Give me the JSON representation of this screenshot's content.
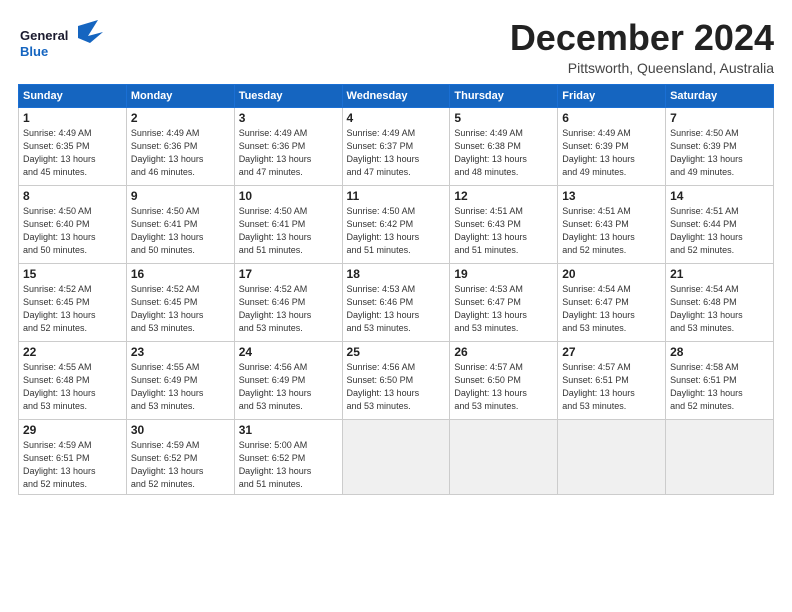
{
  "logo": {
    "general": "General",
    "blue": "Blue",
    "bird": "▶"
  },
  "title": "December 2024",
  "subtitle": "Pittsworth, Queensland, Australia",
  "headers": [
    "Sunday",
    "Monday",
    "Tuesday",
    "Wednesday",
    "Thursday",
    "Friday",
    "Saturday"
  ],
  "weeks": [
    [
      {
        "day": "1",
        "detail": "Sunrise: 4:49 AM\nSunset: 6:35 PM\nDaylight: 13 hours\nand 45 minutes."
      },
      {
        "day": "2",
        "detail": "Sunrise: 4:49 AM\nSunset: 6:36 PM\nDaylight: 13 hours\nand 46 minutes."
      },
      {
        "day": "3",
        "detail": "Sunrise: 4:49 AM\nSunset: 6:36 PM\nDaylight: 13 hours\nand 47 minutes."
      },
      {
        "day": "4",
        "detail": "Sunrise: 4:49 AM\nSunset: 6:37 PM\nDaylight: 13 hours\nand 47 minutes."
      },
      {
        "day": "5",
        "detail": "Sunrise: 4:49 AM\nSunset: 6:38 PM\nDaylight: 13 hours\nand 48 minutes."
      },
      {
        "day": "6",
        "detail": "Sunrise: 4:49 AM\nSunset: 6:39 PM\nDaylight: 13 hours\nand 49 minutes."
      },
      {
        "day": "7",
        "detail": "Sunrise: 4:50 AM\nSunset: 6:39 PM\nDaylight: 13 hours\nand 49 minutes."
      }
    ],
    [
      {
        "day": "8",
        "detail": "Sunrise: 4:50 AM\nSunset: 6:40 PM\nDaylight: 13 hours\nand 50 minutes."
      },
      {
        "day": "9",
        "detail": "Sunrise: 4:50 AM\nSunset: 6:41 PM\nDaylight: 13 hours\nand 50 minutes."
      },
      {
        "day": "10",
        "detail": "Sunrise: 4:50 AM\nSunset: 6:41 PM\nDaylight: 13 hours\nand 51 minutes."
      },
      {
        "day": "11",
        "detail": "Sunrise: 4:50 AM\nSunset: 6:42 PM\nDaylight: 13 hours\nand 51 minutes."
      },
      {
        "day": "12",
        "detail": "Sunrise: 4:51 AM\nSunset: 6:43 PM\nDaylight: 13 hours\nand 51 minutes."
      },
      {
        "day": "13",
        "detail": "Sunrise: 4:51 AM\nSunset: 6:43 PM\nDaylight: 13 hours\nand 52 minutes."
      },
      {
        "day": "14",
        "detail": "Sunrise: 4:51 AM\nSunset: 6:44 PM\nDaylight: 13 hours\nand 52 minutes."
      }
    ],
    [
      {
        "day": "15",
        "detail": "Sunrise: 4:52 AM\nSunset: 6:45 PM\nDaylight: 13 hours\nand 52 minutes."
      },
      {
        "day": "16",
        "detail": "Sunrise: 4:52 AM\nSunset: 6:45 PM\nDaylight: 13 hours\nand 53 minutes."
      },
      {
        "day": "17",
        "detail": "Sunrise: 4:52 AM\nSunset: 6:46 PM\nDaylight: 13 hours\nand 53 minutes."
      },
      {
        "day": "18",
        "detail": "Sunrise: 4:53 AM\nSunset: 6:46 PM\nDaylight: 13 hours\nand 53 minutes."
      },
      {
        "day": "19",
        "detail": "Sunrise: 4:53 AM\nSunset: 6:47 PM\nDaylight: 13 hours\nand 53 minutes."
      },
      {
        "day": "20",
        "detail": "Sunrise: 4:54 AM\nSunset: 6:47 PM\nDaylight: 13 hours\nand 53 minutes."
      },
      {
        "day": "21",
        "detail": "Sunrise: 4:54 AM\nSunset: 6:48 PM\nDaylight: 13 hours\nand 53 minutes."
      }
    ],
    [
      {
        "day": "22",
        "detail": "Sunrise: 4:55 AM\nSunset: 6:48 PM\nDaylight: 13 hours\nand 53 minutes."
      },
      {
        "day": "23",
        "detail": "Sunrise: 4:55 AM\nSunset: 6:49 PM\nDaylight: 13 hours\nand 53 minutes."
      },
      {
        "day": "24",
        "detail": "Sunrise: 4:56 AM\nSunset: 6:49 PM\nDaylight: 13 hours\nand 53 minutes."
      },
      {
        "day": "25",
        "detail": "Sunrise: 4:56 AM\nSunset: 6:50 PM\nDaylight: 13 hours\nand 53 minutes."
      },
      {
        "day": "26",
        "detail": "Sunrise: 4:57 AM\nSunset: 6:50 PM\nDaylight: 13 hours\nand 53 minutes."
      },
      {
        "day": "27",
        "detail": "Sunrise: 4:57 AM\nSunset: 6:51 PM\nDaylight: 13 hours\nand 53 minutes."
      },
      {
        "day": "28",
        "detail": "Sunrise: 4:58 AM\nSunset: 6:51 PM\nDaylight: 13 hours\nand 52 minutes."
      }
    ],
    [
      {
        "day": "29",
        "detail": "Sunrise: 4:59 AM\nSunset: 6:51 PM\nDaylight: 13 hours\nand 52 minutes."
      },
      {
        "day": "30",
        "detail": "Sunrise: 4:59 AM\nSunset: 6:52 PM\nDaylight: 13 hours\nand 52 minutes."
      },
      {
        "day": "31",
        "detail": "Sunrise: 5:00 AM\nSunset: 6:52 PM\nDaylight: 13 hours\nand 51 minutes."
      },
      {
        "day": "",
        "detail": ""
      },
      {
        "day": "",
        "detail": ""
      },
      {
        "day": "",
        "detail": ""
      },
      {
        "day": "",
        "detail": ""
      }
    ]
  ]
}
